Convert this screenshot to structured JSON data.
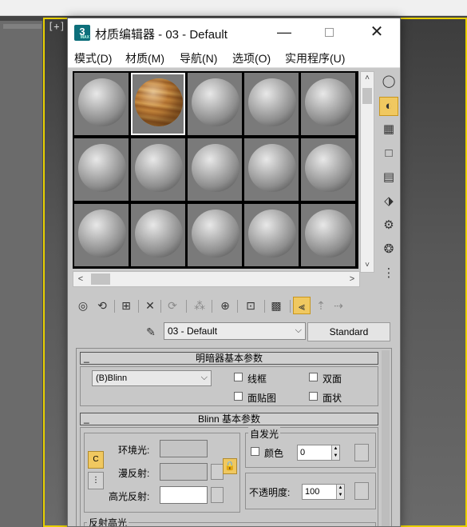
{
  "viewport": {
    "label": "[+]"
  },
  "window": {
    "title": "材质编辑器 - 03 - Default",
    "minimize_glyph": "—",
    "close_glyph": "✕",
    "menu": [
      "模式(D)",
      "材质(M)",
      "导航(N)",
      "选项(O)",
      "实用程序(U)"
    ]
  },
  "slots": {
    "rows": 3,
    "cols": 5,
    "active_index": 1,
    "items": [
      {
        "material": "default-gray"
      },
      {
        "material": "wood"
      },
      {
        "material": "default-gray"
      },
      {
        "material": "default-gray"
      },
      {
        "material": "default-gray"
      },
      {
        "material": "default-gray"
      },
      {
        "material": "default-gray"
      },
      {
        "material": "default-gray"
      },
      {
        "material": "default-gray"
      },
      {
        "material": "default-gray"
      },
      {
        "material": "default-gray"
      },
      {
        "material": "default-gray"
      },
      {
        "material": "default-gray"
      },
      {
        "material": "default-gray"
      },
      {
        "material": "default-gray"
      }
    ]
  },
  "scroll": {
    "up": "˄",
    "down": "˅",
    "left": "<",
    "right": ">"
  },
  "side_tools": [
    {
      "name": "sample-type-icon",
      "glyph": "◯"
    },
    {
      "name": "backlight-icon",
      "glyph": "◐",
      "active": true
    },
    {
      "name": "background-checker-icon",
      "glyph": "▦"
    },
    {
      "name": "sample-uv-tiling-icon",
      "glyph": "□"
    },
    {
      "name": "video-color-check-icon",
      "glyph": "▤"
    },
    {
      "name": "make-preview-icon",
      "glyph": "⬗"
    },
    {
      "name": "options-icon",
      "glyph": "⚙"
    },
    {
      "name": "select-by-material-icon",
      "glyph": "❂"
    },
    {
      "name": "material-map-navigator-icon",
      "glyph": "⋮"
    }
  ],
  "toolbar": [
    {
      "name": "get-material-icon",
      "glyph": "◎"
    },
    {
      "name": "put-to-scene-icon",
      "glyph": "⟲"
    },
    {
      "name": "assign-to-selection-icon",
      "glyph": "⊞"
    },
    {
      "name": "reset-map-icon",
      "glyph": "✕"
    },
    {
      "name": "make-copy-icon",
      "glyph": "⟳",
      "dim": true
    },
    {
      "name": "make-unique-icon",
      "glyph": "⁂",
      "dim": true
    },
    {
      "name": "put-to-library-icon",
      "glyph": "⊕"
    },
    {
      "name": "material-id-channel-icon",
      "glyph": "⊡"
    },
    {
      "name": "show-shaded-in-viewport-icon",
      "glyph": "▩"
    },
    {
      "name": "show-end-result-icon",
      "glyph": "⫷",
      "active": true
    },
    {
      "name": "go-to-parent-icon",
      "glyph": "⇡",
      "dim": true
    },
    {
      "name": "go-forward-to-sibling-icon",
      "glyph": "⇢",
      "dim": true
    }
  ],
  "name_row": {
    "pick_glyph": "✎",
    "material_name": "03 - Default",
    "dropdown_glyph": "⌵",
    "type_button": "Standard"
  },
  "shader_basic": {
    "title": "明暗器基本参数",
    "collapse": "_",
    "shader": "(B)Blinn",
    "dropdown_glyph": "⌵",
    "checkboxes": {
      "wire": "线框",
      "two_sided": "双面",
      "face_map": "面贴图",
      "faceted": "面状"
    }
  },
  "blinn_basic": {
    "title": "Blinn 基本参数",
    "collapse": "_",
    "ambient": "环境光:",
    "diffuse": "漫反射:",
    "specular": "高光反射:",
    "lock_glyph": "🔒",
    "lock_buttons": [
      "C",
      "⋮"
    ],
    "self_illum": {
      "title": "自发光",
      "color_label": "颜色",
      "value": "0"
    },
    "opacity": {
      "label": "不透明度:",
      "value": "100"
    },
    "spec_highlights": "反射高光"
  },
  "colors": {
    "active_button": "#f0c860",
    "viewport_border": "#e8d000",
    "window_bg": "#c8c8c8"
  }
}
